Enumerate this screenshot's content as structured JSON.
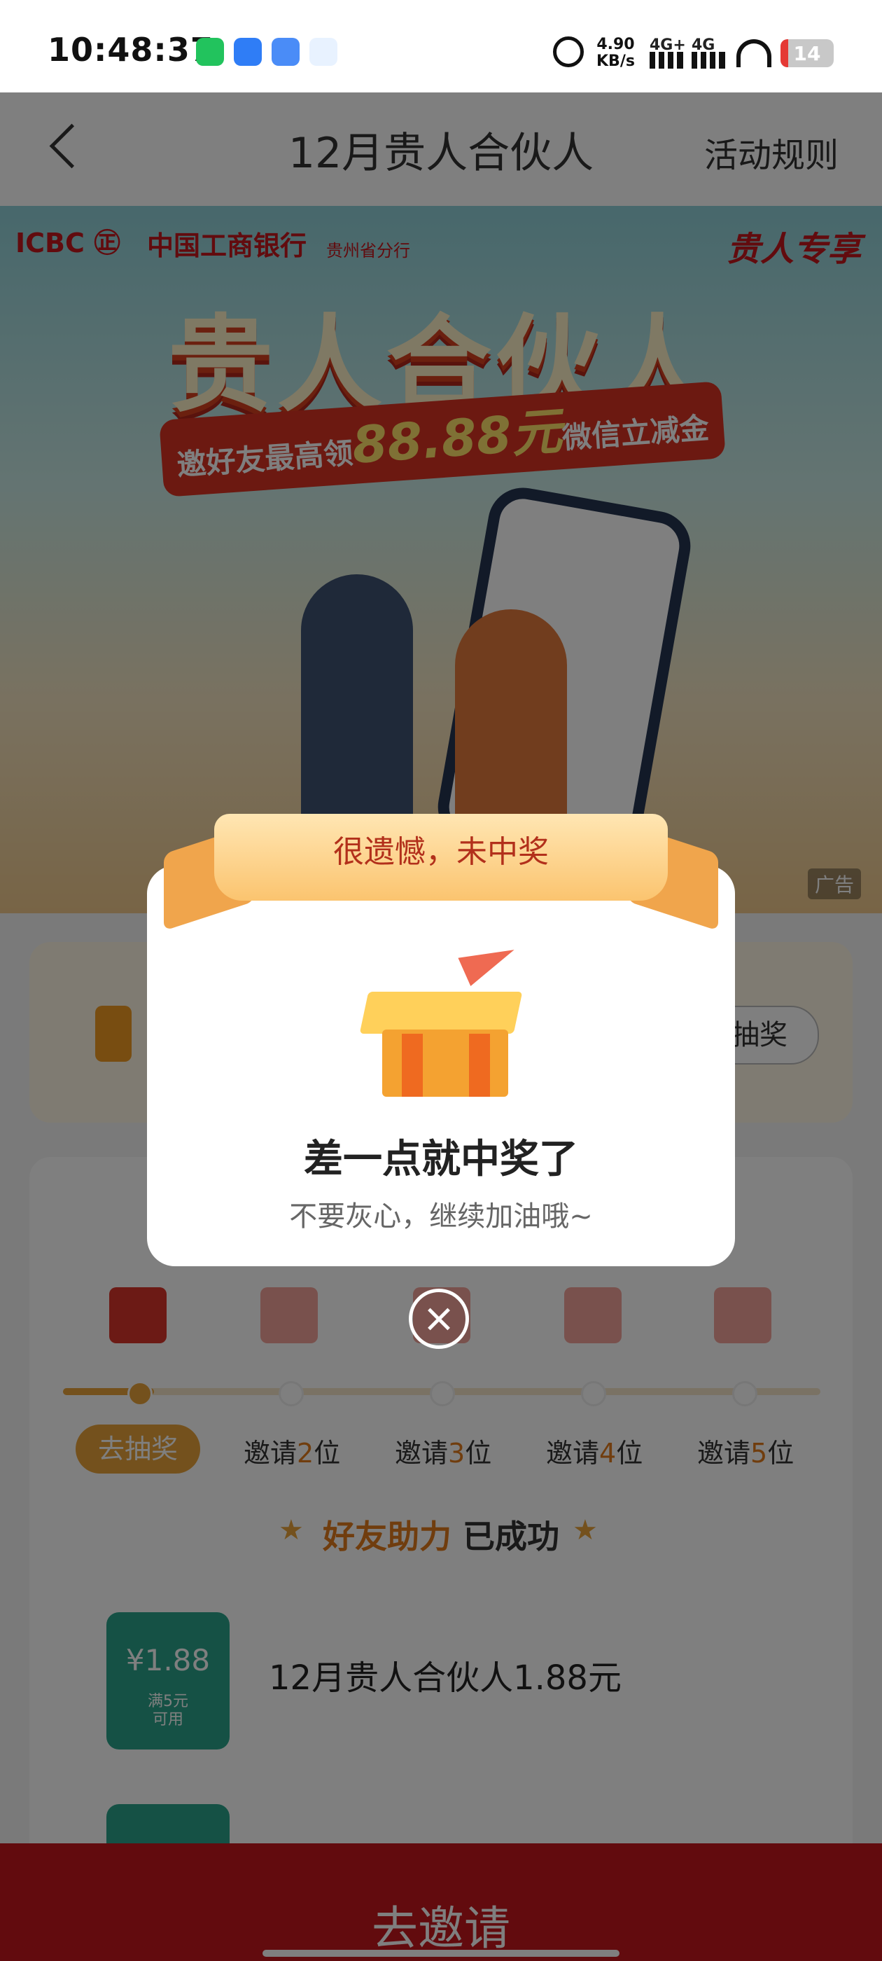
{
  "status_bar": {
    "time": "10:48:37",
    "net_speed": "4.90",
    "net_unit": "KB/s",
    "signal1": "4G+",
    "signal2": "4G",
    "battery": "14",
    "battery_level": 0.14,
    "battery_color": "#e53935"
  },
  "header": {
    "back_icon": "chevron-left-icon",
    "title": "12月贵人合伙人",
    "rules": "活动规则"
  },
  "banner": {
    "logo": "ICBC ㊣",
    "bank_name": "中国工商银行",
    "branch": "贵州省分行",
    "tag": "贵人专享",
    "headline": "贵人合伙人",
    "sub_prefix": "邀好友最高领",
    "sub_amount": "88.88元",
    "sub_suffix": "微信立减金",
    "ad": "广告"
  },
  "card1": {
    "button": "抽奖"
  },
  "progress": {
    "fill": 0.12,
    "steps": [
      {
        "label": "去抽奖"
      },
      {
        "pre": "邀请",
        "num": "2",
        "post": "位"
      },
      {
        "pre": "邀请",
        "num": "3",
        "post": "位"
      },
      {
        "pre": "邀请",
        "num": "4",
        "post": "位"
      },
      {
        "pre": "邀请",
        "num": "5",
        "post": "位"
      }
    ]
  },
  "success": {
    "highlight": "好友助力",
    "rest": "已成功"
  },
  "reward": {
    "value": "¥1.88",
    "cond_line1": "满5元",
    "cond_line2": "可用",
    "name": "12月贵人合伙人1.88元"
  },
  "bottom": {
    "invite": "去邀请"
  },
  "modal": {
    "ribbon": "很遗憾，未中奖",
    "title": "差一点就中奖了",
    "subtitle": "不要灰心，继续加油哦~",
    "close_icon": "close-icon"
  },
  "colors": {
    "brand_red": "#c4161c",
    "accent_orange": "#e8a33a",
    "coupon_green": "#2aa38b"
  }
}
